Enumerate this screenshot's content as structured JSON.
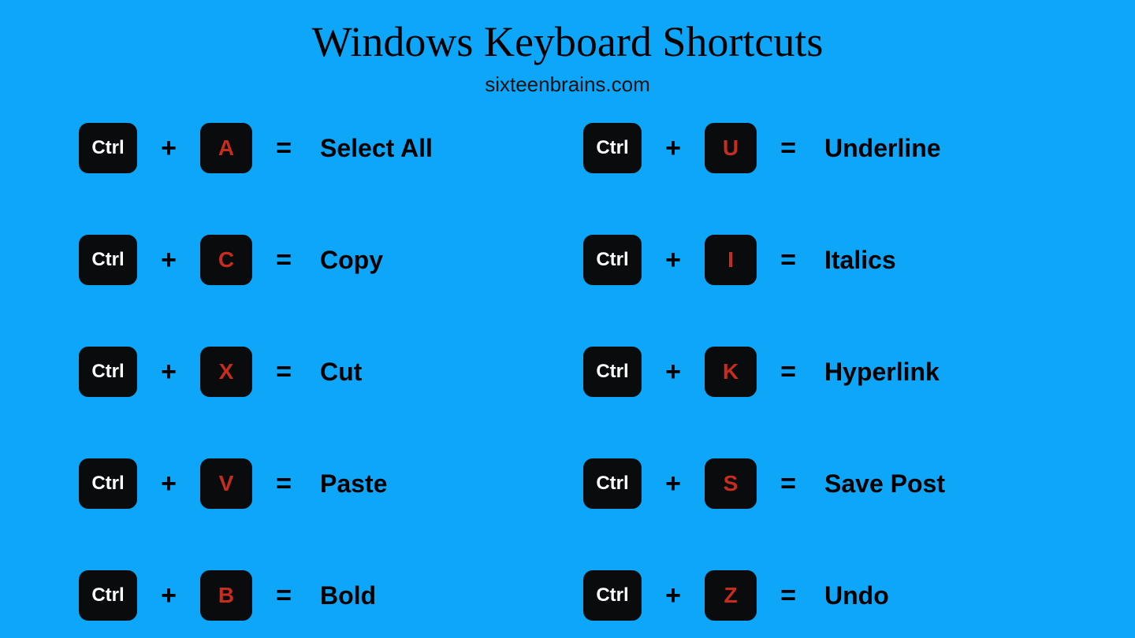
{
  "title": "Windows Keyboard Shortcuts",
  "subtitle": "sixteenbrains.com",
  "ctrl_label": "Ctrl",
  "plus": "+",
  "equals": "=",
  "shortcuts": [
    {
      "key": "A",
      "action": "Select All"
    },
    {
      "key": "U",
      "action": "Underline"
    },
    {
      "key": "C",
      "action": "Copy"
    },
    {
      "key": "I",
      "action": "Italics"
    },
    {
      "key": "X",
      "action": "Cut"
    },
    {
      "key": "K",
      "action": "Hyperlink"
    },
    {
      "key": "V",
      "action": "Paste"
    },
    {
      "key": "S",
      "action": "Save Post"
    },
    {
      "key": "B",
      "action": "Bold"
    },
    {
      "key": "Z",
      "action": "Undo"
    }
  ]
}
